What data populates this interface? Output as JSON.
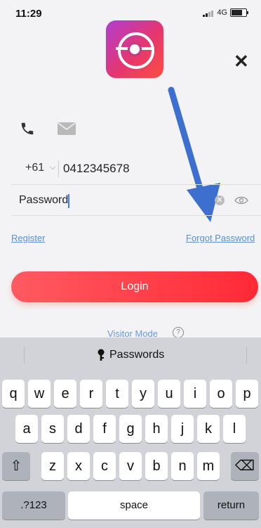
{
  "status": {
    "time": "11:29",
    "network": "4G"
  },
  "login": {
    "country_code": "+61",
    "phone": "0412345678",
    "password_placeholder": "Password",
    "register": "Register",
    "forgot_password": "Forgot Password",
    "login_button": "Login",
    "visitor_mode": "Visitor Mode",
    "help_symbol": "?"
  },
  "keyboard": {
    "suggestion": "Passwords",
    "row1": [
      "q",
      "w",
      "e",
      "r",
      "t",
      "y",
      "u",
      "i",
      "o",
      "p"
    ],
    "row2": [
      "a",
      "s",
      "d",
      "f",
      "g",
      "h",
      "j",
      "k",
      "l"
    ],
    "row3": [
      "z",
      "x",
      "c",
      "v",
      "b",
      "n",
      "m"
    ],
    "numbers_key": ".?123",
    "space_key": "space",
    "return_key": "return"
  },
  "colors": {
    "accent": "#ff3b44",
    "link": "#5b8fd6",
    "arrow": "#3d6fcf"
  }
}
